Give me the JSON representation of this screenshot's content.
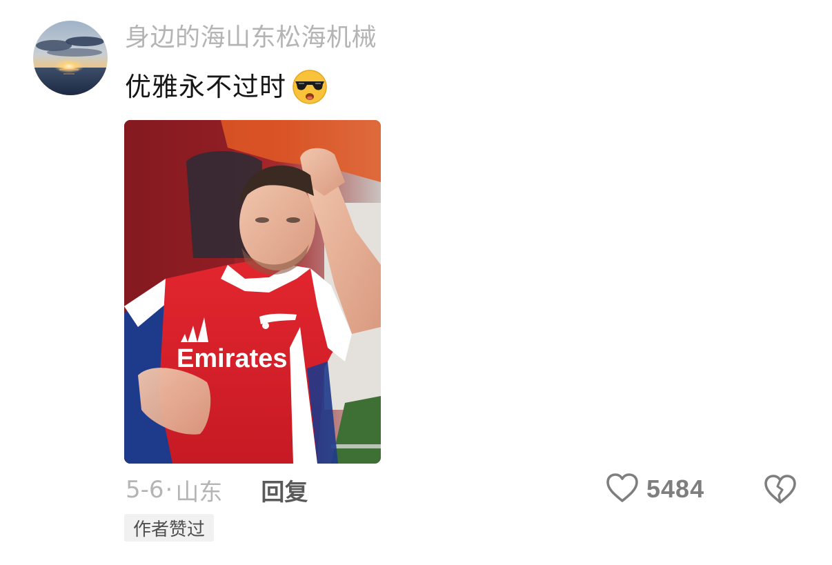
{
  "comment": {
    "username": "身边的海山东松海机械",
    "text": "优雅永不过时",
    "emoji": "sunglasses-emoji",
    "photo_jersey_text": "Emirates",
    "date": "5-6",
    "separator": "·",
    "location": "山东",
    "reply_label": "回复",
    "author_badge": "作者赞过",
    "like_count": "5484"
  },
  "icons": {
    "like": "heart-outline-icon",
    "dislike": "broken-heart-icon"
  },
  "colors": {
    "username": "#b4b4b4",
    "text": "#161616",
    "meta": "#b4b4b4",
    "reply": "#5a5a5a",
    "icon": "#7e7e7e",
    "badge_bg": "#f1f1f1"
  }
}
